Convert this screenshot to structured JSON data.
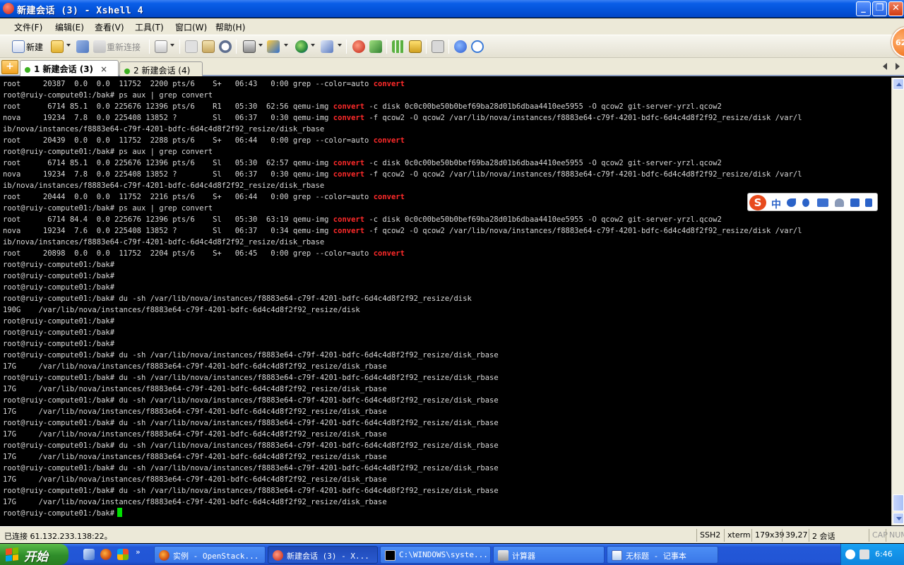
{
  "window": {
    "title": "新建会话 (3) - Xshell 4",
    "buttons": [
      "_",
      "❐",
      "✕"
    ]
  },
  "menu": [
    "文件(F)",
    "编辑(E)",
    "查看(V)",
    "工具(T)",
    "窗口(W)",
    "帮助(H)"
  ],
  "toolbar": {
    "new_label": "新建",
    "reconnect_label": "重新连接"
  },
  "tabs": [
    {
      "num": "1",
      "label": "新建会话 (3)",
      "close": "×",
      "active": true
    },
    {
      "num": "2",
      "label": "新建会话 (4)",
      "active": false
    }
  ],
  "terminal": {
    "lines": [
      {
        "pre": "root     20387  0.0  0.0  11752  2200 pts/6    S+   06:43   0:00 grep --color=auto ",
        "hl": "convert",
        "post": ""
      },
      {
        "pre": "root@ruiy-compute01:/bak# ps aux | grep convert",
        "hl": "",
        "post": ""
      },
      {
        "pre": "root      6714 85.1  0.0 225676 12396 pts/6    R1   05:30  62:56 qemu-img ",
        "hl": "convert",
        "post": " -c disk 0c0c00be50b0bef69ba28d01b6dbaa4410ee5955 -O qcow2 git-server-yrzl.qcow2"
      },
      {
        "pre": "nova     19234  7.8  0.0 225408 13852 ?        Sl   06:37   0:30 qemu-img ",
        "hl": "convert",
        "post": " -f qcow2 -O qcow2 /var/lib/nova/instances/f8883e64-c79f-4201-bdfc-6d4c4d8f2f92_resize/disk /var/l"
      },
      {
        "pre": "ib/nova/instances/f8883e64-c79f-4201-bdfc-6d4c4d8f2f92_resize/disk_rbase",
        "hl": "",
        "post": ""
      },
      {
        "pre": "root     20439  0.0  0.0  11752  2288 pts/6    S+   06:44   0:00 grep --color=auto ",
        "hl": "convert",
        "post": ""
      },
      {
        "pre": "root@ruiy-compute01:/bak# ps aux | grep convert",
        "hl": "",
        "post": ""
      },
      {
        "pre": "root      6714 85.1  0.0 225676 12396 pts/6    Sl   05:30  62:57 qemu-img ",
        "hl": "convert",
        "post": " -c disk 0c0c00be50b0bef69ba28d01b6dbaa4410ee5955 -O qcow2 git-server-yrzl.qcow2"
      },
      {
        "pre": "nova     19234  7.8  0.0 225408 13852 ?        Sl   06:37   0:30 qemu-img ",
        "hl": "convert",
        "post": " -f qcow2 -O qcow2 /var/lib/nova/instances/f8883e64-c79f-4201-bdfc-6d4c4d8f2f92_resize/disk /var/l"
      },
      {
        "pre": "ib/nova/instances/f8883e64-c79f-4201-bdfc-6d4c4d8f2f92_resize/disk_rbase",
        "hl": "",
        "post": ""
      },
      {
        "pre": "root     20444  0.0  0.0  11752  2216 pts/6    S+   06:44   0:00 grep --color=auto ",
        "hl": "convert",
        "post": ""
      },
      {
        "pre": "root@ruiy-compute01:/bak# ps aux | grep convert",
        "hl": "",
        "post": ""
      },
      {
        "pre": "root      6714 84.4  0.0 225676 12396 pts/6    Sl   05:30  63:19 qemu-img ",
        "hl": "convert",
        "post": " -c disk 0c0c00be50b0bef69ba28d01b6dbaa4410ee5955 -O qcow2 git-server-yrzl.qcow2"
      },
      {
        "pre": "nova     19234  7.6  0.0 225408 13852 ?        Sl   06:37   0:34 qemu-img ",
        "hl": "convert",
        "post": " -f qcow2 -O qcow2 /var/lib/nova/instances/f8883e64-c79f-4201-bdfc-6d4c4d8f2f92_resize/disk /var/l"
      },
      {
        "pre": "ib/nova/instances/f8883e64-c79f-4201-bdfc-6d4c4d8f2f92_resize/disk_rbase",
        "hl": "",
        "post": ""
      },
      {
        "pre": "root     20898  0.0  0.0  11752  2204 pts/6    S+   06:45   0:00 grep --color=auto ",
        "hl": "convert",
        "post": ""
      },
      {
        "pre": "root@ruiy-compute01:/bak#",
        "hl": "",
        "post": ""
      },
      {
        "pre": "root@ruiy-compute01:/bak#",
        "hl": "",
        "post": ""
      },
      {
        "pre": "root@ruiy-compute01:/bak#",
        "hl": "",
        "post": ""
      },
      {
        "pre": "root@ruiy-compute01:/bak# du -sh /var/lib/nova/instances/f8883e64-c79f-4201-bdfc-6d4c4d8f2f92_resize/disk",
        "hl": "",
        "post": ""
      },
      {
        "pre": "190G    /var/lib/nova/instances/f8883e64-c79f-4201-bdfc-6d4c4d8f2f92_resize/disk",
        "hl": "",
        "post": ""
      },
      {
        "pre": "root@ruiy-compute01:/bak#",
        "hl": "",
        "post": ""
      },
      {
        "pre": "root@ruiy-compute01:/bak#",
        "hl": "",
        "post": ""
      },
      {
        "pre": "root@ruiy-compute01:/bak#",
        "hl": "",
        "post": ""
      },
      {
        "pre": "root@ruiy-compute01:/bak# du -sh /var/lib/nova/instances/f8883e64-c79f-4201-bdfc-6d4c4d8f2f92_resize/disk_rbase",
        "hl": "",
        "post": ""
      },
      {
        "pre": "17G     /var/lib/nova/instances/f8883e64-c79f-4201-bdfc-6d4c4d8f2f92_resize/disk_rbase",
        "hl": "",
        "post": ""
      },
      {
        "pre": "root@ruiy-compute01:/bak# du -sh /var/lib/nova/instances/f8883e64-c79f-4201-bdfc-6d4c4d8f2f92_resize/disk_rbase",
        "hl": "",
        "post": ""
      },
      {
        "pre": "17G     /var/lib/nova/instances/f8883e64-c79f-4201-bdfc-6d4c4d8f2f92_resize/disk_rbase",
        "hl": "",
        "post": ""
      },
      {
        "pre": "root@ruiy-compute01:/bak# du -sh /var/lib/nova/instances/f8883e64-c79f-4201-bdfc-6d4c4d8f2f92_resize/disk_rbase",
        "hl": "",
        "post": ""
      },
      {
        "pre": "17G     /var/lib/nova/instances/f8883e64-c79f-4201-bdfc-6d4c4d8f2f92_resize/disk_rbase",
        "hl": "",
        "post": ""
      },
      {
        "pre": "root@ruiy-compute01:/bak# du -sh /var/lib/nova/instances/f8883e64-c79f-4201-bdfc-6d4c4d8f2f92_resize/disk_rbase",
        "hl": "",
        "post": ""
      },
      {
        "pre": "17G     /var/lib/nova/instances/f8883e64-c79f-4201-bdfc-6d4c4d8f2f92_resize/disk_rbase",
        "hl": "",
        "post": ""
      },
      {
        "pre": "root@ruiy-compute01:/bak# du -sh /var/lib/nova/instances/f8883e64-c79f-4201-bdfc-6d4c4d8f2f92_resize/disk_rbase",
        "hl": "",
        "post": ""
      },
      {
        "pre": "17G     /var/lib/nova/instances/f8883e64-c79f-4201-bdfc-6d4c4d8f2f92_resize/disk_rbase",
        "hl": "",
        "post": ""
      },
      {
        "pre": "root@ruiy-compute01:/bak# du -sh /var/lib/nova/instances/f8883e64-c79f-4201-bdfc-6d4c4d8f2f92_resize/disk_rbase",
        "hl": "",
        "post": ""
      },
      {
        "pre": "17G     /var/lib/nova/instances/f8883e64-c79f-4201-bdfc-6d4c4d8f2f92_resize/disk_rbase",
        "hl": "",
        "post": ""
      },
      {
        "pre": "root@ruiy-compute01:/bak# du -sh /var/lib/nova/instances/f8883e64-c79f-4201-bdfc-6d4c4d8f2f92_resize/disk_rbase",
        "hl": "",
        "post": ""
      },
      {
        "pre": "17G     /var/lib/nova/instances/f8883e64-c79f-4201-bdfc-6d4c4d8f2f92_resize/disk_rbase",
        "hl": "",
        "post": ""
      }
    ],
    "prompt": "root@ruiy-compute01:/bak#",
    "highlight_color": "#ff2a2a",
    "cursor_color": "#00e000"
  },
  "ime": {
    "logo": "S",
    "mode": "中"
  },
  "badge": {
    "value": "62"
  },
  "status": {
    "connection": "已连接 61.132.233.138:22。",
    "protocol": "SSH2",
    "terminal_type": "xterm",
    "size": "179x39",
    "cursor_pos": "39,27",
    "sessions": "2 会话",
    "cap": "CAP",
    "num": "NUM"
  },
  "taskbar": {
    "start_label": "开始",
    "tasks": [
      {
        "label": "实例 - OpenStack...",
        "icon": "firefox-icon",
        "active": false
      },
      {
        "label": "新建会话 (3) - X...",
        "icon": "xshell-icon",
        "active": true
      },
      {
        "label": "C:\\WINDOWS\\syste...",
        "icon": "cmd-icon",
        "active": false
      },
      {
        "label": "计算器",
        "icon": "calculator-icon",
        "active": false
      },
      {
        "label": "无标题 - 记事本",
        "icon": "notepad-icon",
        "active": false
      }
    ],
    "clock": "6:46"
  }
}
